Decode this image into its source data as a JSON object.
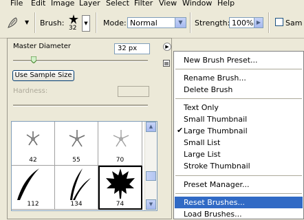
{
  "menubar": {
    "items": [
      "File",
      "Edit",
      "Image",
      "Layer",
      "Select",
      "Filter",
      "View",
      "Window",
      "Help"
    ]
  },
  "options_bar": {
    "brush_label": "Brush:",
    "brush_size": "32",
    "mode_label": "Mode:",
    "mode_value": "Normal",
    "strength_label": "Strength:",
    "strength_value": "100%",
    "sample_label": "Sam"
  },
  "brush_panel": {
    "master_diameter_label": "Master Diameter",
    "master_diameter_value": "32 px",
    "use_sample_size_label": "Use Sample Size",
    "hardness_label": "Hardness:",
    "brushes": [
      {
        "size": "42",
        "shape": "star"
      },
      {
        "size": "55",
        "shape": "star"
      },
      {
        "size": "70",
        "shape": "star"
      },
      {
        "size": "112",
        "shape": "grass-single"
      },
      {
        "size": "134",
        "shape": "grass-double"
      },
      {
        "size": "74",
        "shape": "maple-leaf",
        "selected": true
      }
    ]
  },
  "context_menu": {
    "items": [
      {
        "label": "New Brush Preset...",
        "group": 1
      },
      {
        "label": "Rename Brush...",
        "group": 2
      },
      {
        "label": "Delete Brush",
        "group": 2
      },
      {
        "label": "Text Only",
        "group": 3
      },
      {
        "label": "Small Thumbnail",
        "group": 3
      },
      {
        "label": "Large Thumbnail",
        "group": 3,
        "checked": true
      },
      {
        "label": "Small List",
        "group": 3
      },
      {
        "label": "Large List",
        "group": 3
      },
      {
        "label": "Stroke Thumbnail",
        "group": 3
      },
      {
        "label": "Preset Manager...",
        "group": 4
      },
      {
        "label": "Reset Brushes...",
        "group": 5,
        "highlighted": true
      },
      {
        "label": "Load Brushes...",
        "group": 5
      }
    ]
  },
  "colors": {
    "chrome": "#ece9d8",
    "highlight": "#316ac5",
    "input_border": "#7f9db9"
  }
}
